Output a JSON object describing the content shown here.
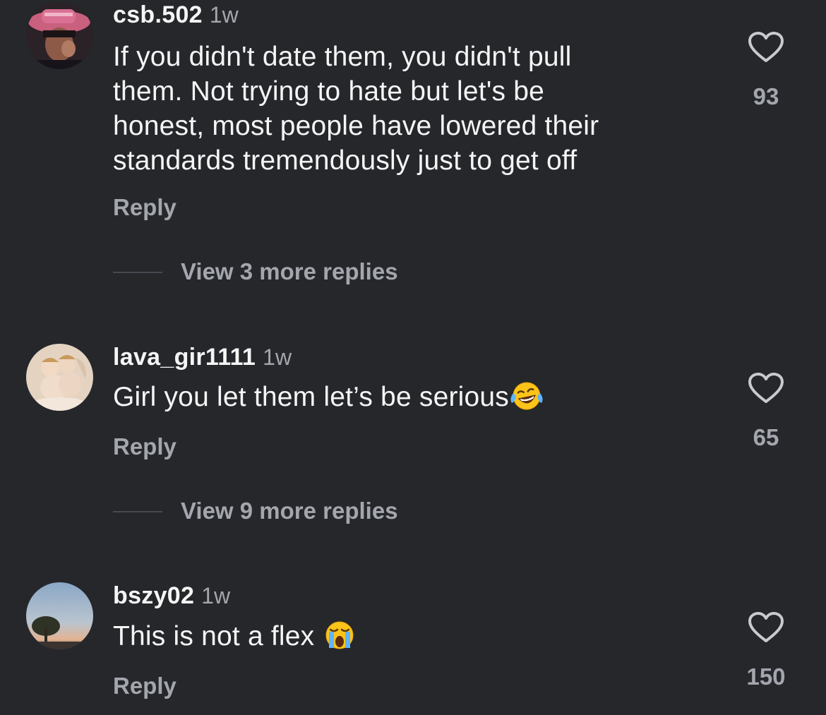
{
  "comments": [
    {
      "username": "csb.502",
      "time": "1w",
      "text_lines": [
        "If you didn't date them, you didn't pull",
        "them. Not trying to hate but let's be",
        "honest, most people have lowered their",
        "standards tremendously just to get off"
      ],
      "reply_label": "Reply",
      "likes": "93",
      "view_more_label": "View 3 more replies"
    },
    {
      "username": "lava_gir1111",
      "time": "1w",
      "text": "Girl you let them let’s be serious",
      "emoji": "face-with-tears-of-joy",
      "reply_label": "Reply",
      "likes": "65",
      "view_more_label": "View 9 more replies"
    },
    {
      "username": "bszy02",
      "time": "1w",
      "text": "This is not a flex ",
      "emoji": "loudly-crying-face",
      "reply_label": "Reply",
      "likes": "150"
    }
  ],
  "colors": {
    "background": "#25272b",
    "primary_text": "#f5f5f5",
    "secondary_text": "#a3a6ad"
  }
}
